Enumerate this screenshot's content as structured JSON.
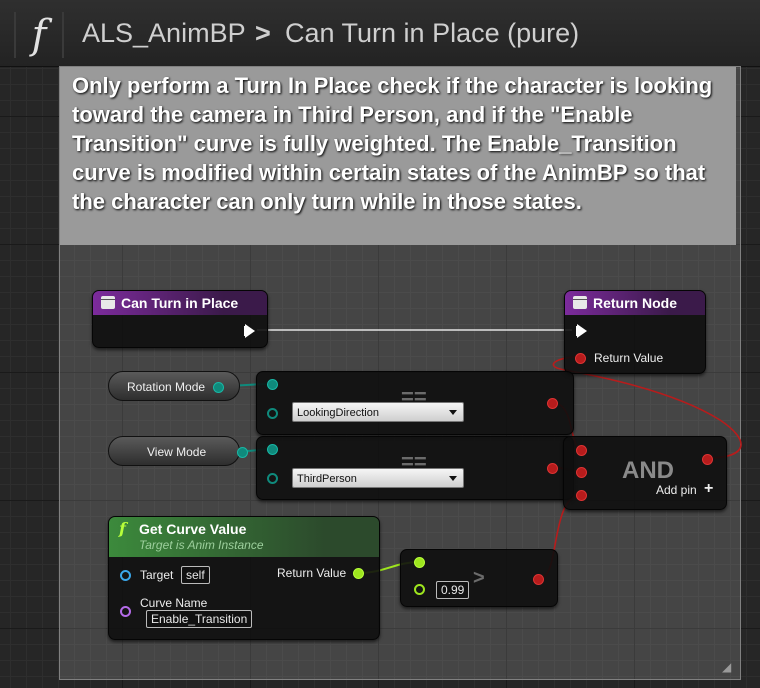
{
  "breadcrumb": {
    "function_glyph": "f",
    "blueprint": "ALS_AnimBP",
    "separator": ">",
    "function": "Can Turn in Place (pure)"
  },
  "comment": {
    "text": "Only perform a Turn In Place check if the character is looking toward the camera in Third Person, and if the \"Enable Transition\" curve is fully weighted. The Enable_Transition curve is modified within certain states of the AnimBP so that the character can only turn while in those states."
  },
  "nodes": {
    "entry": {
      "title": "Can Turn in Place"
    },
    "return": {
      "title": "Return Node",
      "pin_label": "Return Value"
    },
    "rotation_mode": {
      "label": "Rotation Mode"
    },
    "view_mode": {
      "label": "View Mode"
    },
    "equal1": {
      "symbol": "==",
      "enum_value": "LookingDirection"
    },
    "equal2": {
      "symbol": "==",
      "enum_value": "ThirdPerson"
    },
    "and_node": {
      "label": "AND",
      "add_pin_label": "Add pin",
      "add_pin_icon": "+"
    },
    "get_curve": {
      "glyph": "f",
      "title": "Get Curve Value",
      "subtitle": "Target is Anim Instance",
      "target_label": "Target",
      "target_value": "self",
      "return_label": "Return Value",
      "curve_name_label": "Curve Name",
      "curve_name_value": "Enable_Transition"
    },
    "greater": {
      "symbol": ">",
      "value": "0.99"
    }
  },
  "colors": {
    "bool_wire": "#b71c1c",
    "enum_wire": "#0f8a7c",
    "float_wire": "#9ee61e",
    "exec_wire": "#ffffff",
    "function_header": "#7c2b9c",
    "pure_header": "#3c8a3c"
  }
}
